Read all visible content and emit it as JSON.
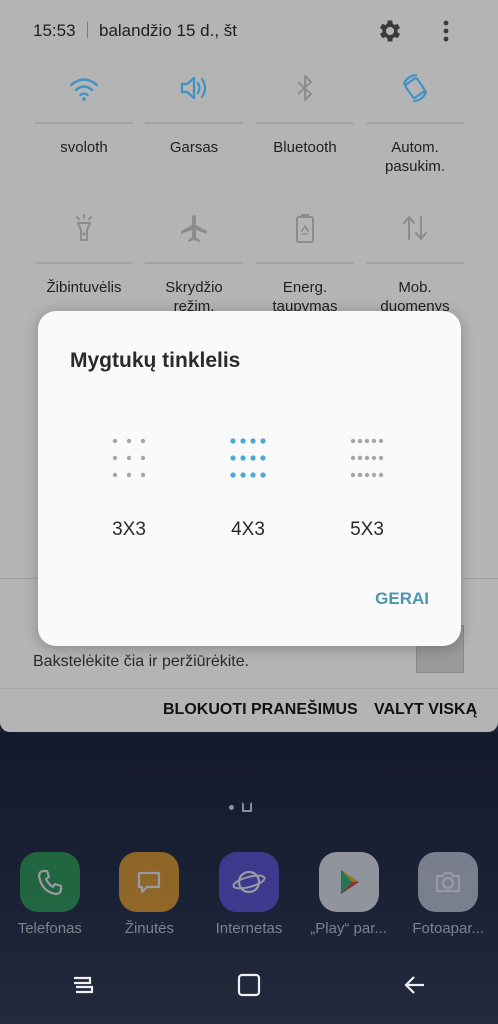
{
  "statusbar": {
    "time": "15:53",
    "date": "balandžio 15 d., št",
    "settings_icon": "gear-icon",
    "more_icon": "more-vert-icon"
  },
  "quick_settings": [
    {
      "label": "svoloth",
      "icon": "wifi-icon",
      "active": true
    },
    {
      "label": "Garsas",
      "icon": "volume-icon",
      "active": true
    },
    {
      "label": "Bluetooth",
      "icon": "bluetooth-icon",
      "active": false
    },
    {
      "label": "Autom.\npasukim.",
      "icon": "auto-rotate-icon",
      "active": true
    },
    {
      "label": "Žibintuvėlis",
      "icon": "flashlight-icon",
      "active": false
    },
    {
      "label": "Skrydžio\nrežim.",
      "icon": "airplane-icon",
      "active": false
    },
    {
      "label": "Energ.\ntaupymas",
      "icon": "battery-saver-icon",
      "active": false
    },
    {
      "label": "Mob.\nduomenys",
      "icon": "mobile-data-icon",
      "active": false
    }
  ],
  "dialog": {
    "title": "Mygtukų tinklelis",
    "options": [
      {
        "label": "3X3",
        "cols": 3,
        "rows": 3,
        "selected": false
      },
      {
        "label": "4X3",
        "cols": 4,
        "rows": 3,
        "selected": true
      },
      {
        "label": "5X3",
        "cols": 5,
        "rows": 3,
        "selected": false
      }
    ],
    "ok_label": "GERAI"
  },
  "notification": {
    "body": "Bakstelėkite čia ir peržiūrėkite."
  },
  "notification_actions": {
    "block": "BLOKUOTI PRANEŠIMUS",
    "clear": "VALYT VISKĄ"
  },
  "dock": [
    {
      "label": "Telefonas",
      "icon": "phone-icon",
      "color": "#27a04a"
    },
    {
      "label": "Žinutės",
      "icon": "messages-icon",
      "color": "#f0a020"
    },
    {
      "label": "Internetas",
      "icon": "internet-icon",
      "color": "#5b4fd6"
    },
    {
      "label": "„Play“ par...",
      "icon": "play-store-icon",
      "color": "#f2f2f2"
    },
    {
      "label": "Fotoapar...",
      "icon": "camera-icon",
      "color": "#c9ccd6"
    }
  ],
  "colors": {
    "accent": "#4f95ae",
    "dot_selected": "#4aa8d8",
    "dot_unselected": "#a6a6a6",
    "tile_active": "#3f93c6",
    "tile_inactive": "#8c8c8c"
  }
}
